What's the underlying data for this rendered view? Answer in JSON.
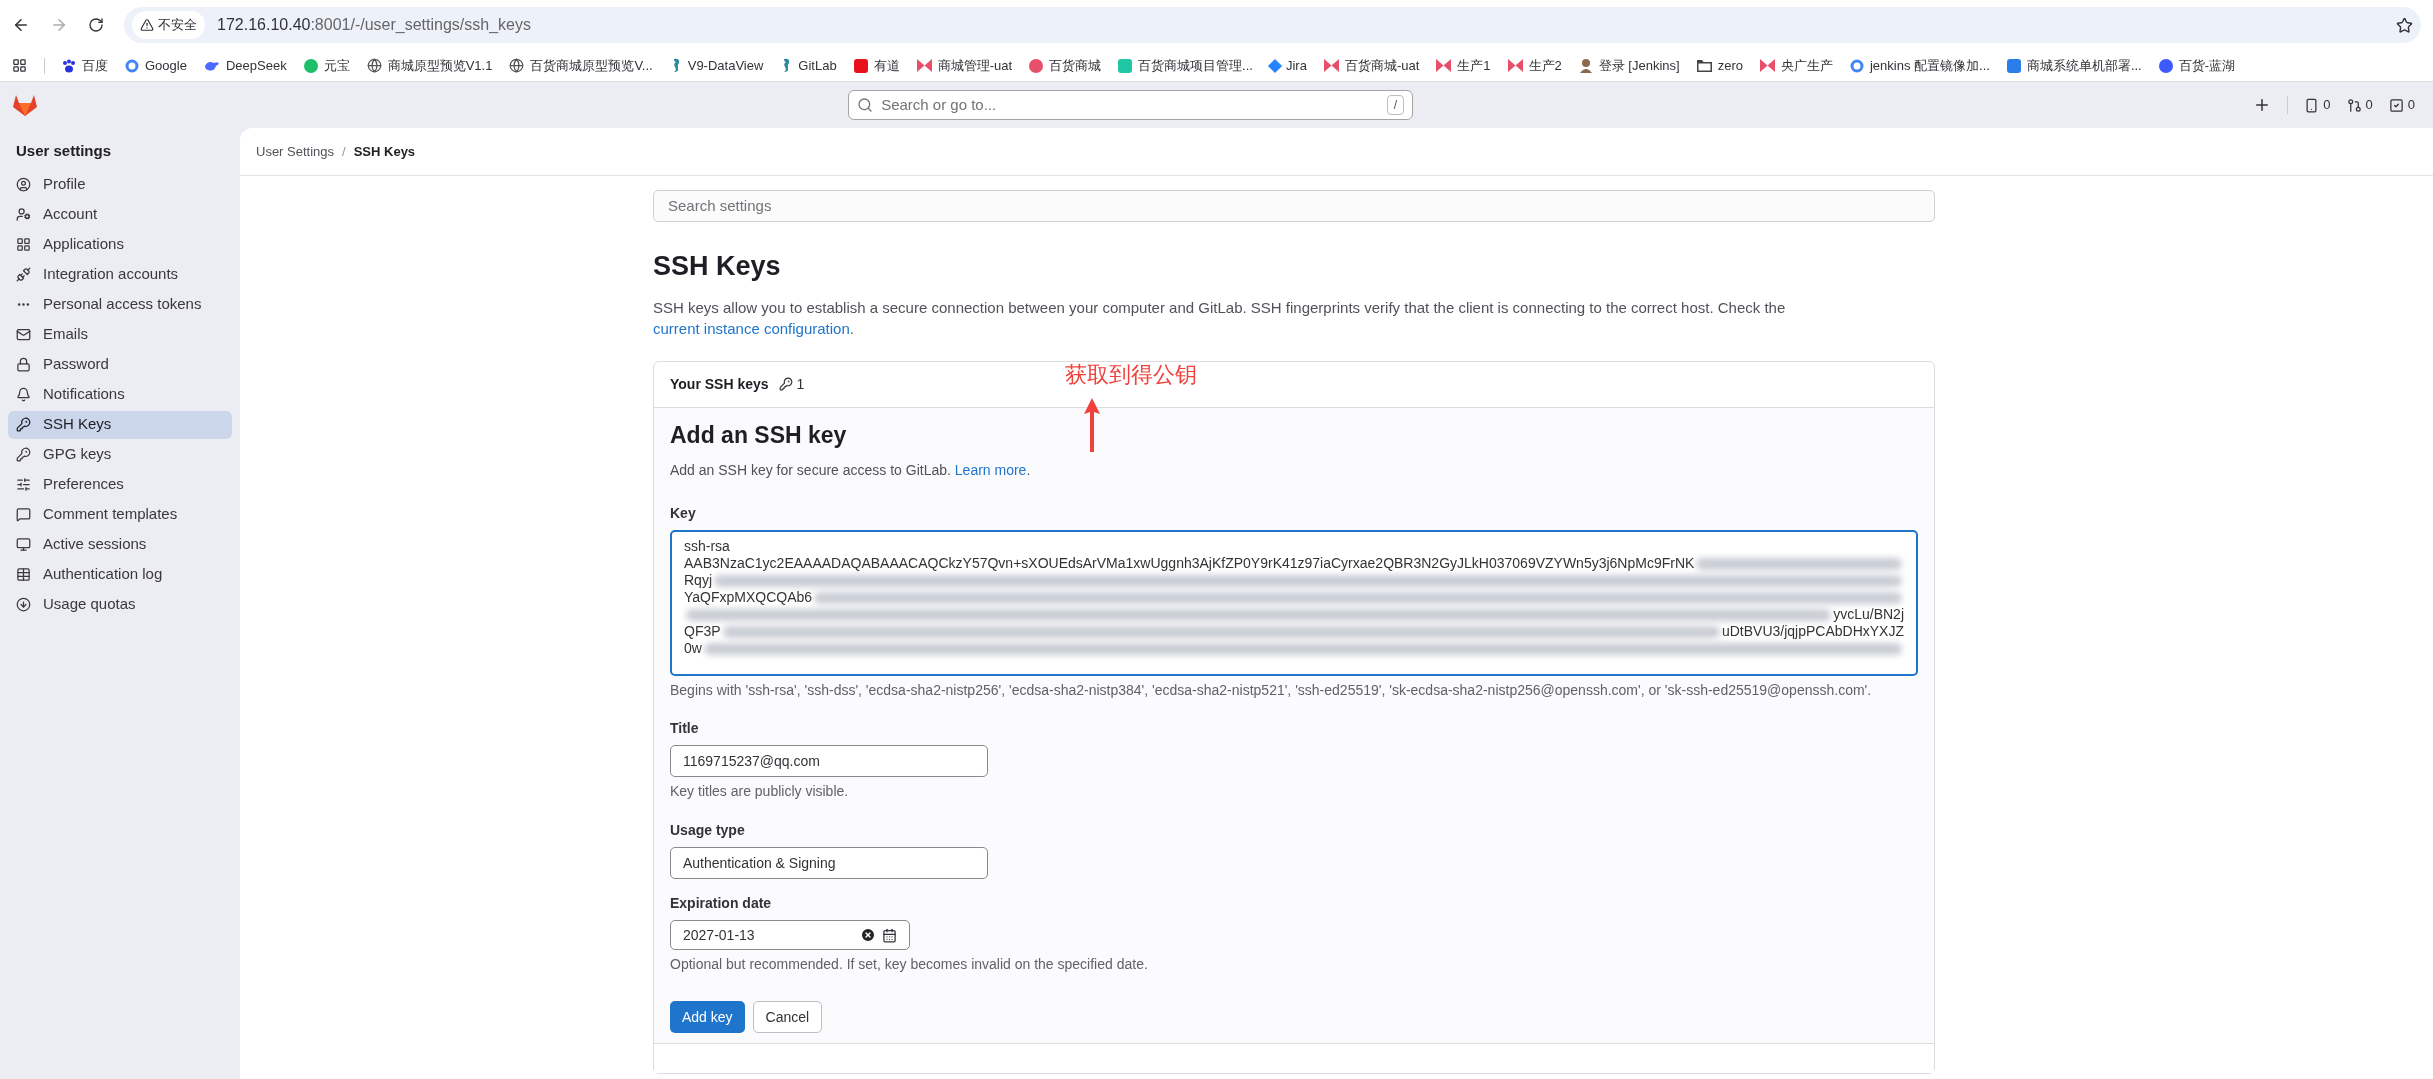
{
  "browser": {
    "security_label": "不安全",
    "url_host": "172.16.10.40",
    "url_rest": ":8001/-/user_settings/ssh_keys"
  },
  "bookmarks": [
    {
      "label": "百度",
      "kind": "paw",
      "color": "#2932e1"
    },
    {
      "label": "Google",
      "kind": "letter",
      "color": "#4285f4"
    },
    {
      "label": "DeepSeek",
      "kind": "whale",
      "color": "#4d6bfe"
    },
    {
      "label": "元宝",
      "kind": "circle",
      "color": "#1ebf6a"
    },
    {
      "label": "商城原型预览V1.1",
      "kind": "globe",
      "color": "#555555"
    },
    {
      "label": "百货商城原型预览V...",
      "kind": "globe",
      "color": "#555555"
    },
    {
      "label": "V9-DataView",
      "kind": "seahorse",
      "color": "#2e8b9a"
    },
    {
      "label": "GitLab",
      "kind": "seahorse",
      "color": "#2e8b9a"
    },
    {
      "label": "有道",
      "kind": "square",
      "color": "#e8111b"
    },
    {
      "label": "商城管理-uat",
      "kind": "bow",
      "color": "#e84f6b"
    },
    {
      "label": "百货商城",
      "kind": "circle",
      "color": "#e84f6b"
    },
    {
      "label": "百货商城项目管理...",
      "kind": "square",
      "color": "#1fc7a4"
    },
    {
      "label": "Jira",
      "kind": "diamond",
      "color": "#2684ff"
    },
    {
      "label": "百货商城-uat",
      "kind": "bow",
      "color": "#e84f6b"
    },
    {
      "label": "生产1",
      "kind": "bow",
      "color": "#e84f6b"
    },
    {
      "label": "生产2",
      "kind": "bow",
      "color": "#e84f6b"
    },
    {
      "label": "登录 [Jenkins]",
      "kind": "figure",
      "color": "#8a6a4f"
    },
    {
      "label": "zero",
      "kind": "folder",
      "color": "#444444"
    },
    {
      "label": "央广生产",
      "kind": "bow",
      "color": "#e84f6b"
    },
    {
      "label": "jenkins 配置镜像加...",
      "kind": "letter",
      "color": "#4285f4"
    },
    {
      "label": "商城系统单机部署...",
      "kind": "square",
      "color": "#2b7de9"
    },
    {
      "label": "百货-蓝湖",
      "kind": "circle",
      "color": "#3d5afe"
    }
  ],
  "topbar": {
    "search_placeholder": "Search or go to...",
    "shortcut": "/",
    "counters": [
      "0",
      "0",
      "0"
    ]
  },
  "sidebar": {
    "title": "User settings",
    "items": [
      {
        "label": "Profile",
        "selected": false
      },
      {
        "label": "Account",
        "selected": false
      },
      {
        "label": "Applications",
        "selected": false
      },
      {
        "label": "Integration accounts",
        "selected": false
      },
      {
        "label": "Personal access tokens",
        "selected": false
      },
      {
        "label": "Emails",
        "selected": false
      },
      {
        "label": "Password",
        "selected": false
      },
      {
        "label": "Notifications",
        "selected": false
      },
      {
        "label": "SSH Keys",
        "selected": true
      },
      {
        "label": "GPG keys",
        "selected": false
      },
      {
        "label": "Preferences",
        "selected": false
      },
      {
        "label": "Comment templates",
        "selected": false
      },
      {
        "label": "Active sessions",
        "selected": false
      },
      {
        "label": "Authentication log",
        "selected": false
      },
      {
        "label": "Usage quotas",
        "selected": false
      }
    ]
  },
  "breadcrumbs": [
    "User Settings",
    "SSH Keys"
  ],
  "breadcrumb_separator": "/",
  "search_settings": {
    "placeholder": "Search settings"
  },
  "page": {
    "title": "SSH Keys",
    "intro": "SSH keys allow you to establish a secure connection between your computer and GitLab. SSH fingerprints verify that the client is connecting to the correct host. Check the",
    "intro_link": "current instance configuration",
    "intro_end": "."
  },
  "card": {
    "header": "Your SSH keys",
    "count": "1",
    "form_title": "Add an SSH key",
    "form_intro": "Add an SSH key for secure access to GitLab.",
    "form_link": "Learn more",
    "form_intro_end": ".",
    "key": {
      "label": "Key",
      "first_line": "ssh-rsa",
      "rows": [
        {
          "left": "AAB3NzaC1yc2EAAAADAQABAAACAQCkzY57Qvn+sXOUEdsArVMa1xwUggnh3AjKfZP0Y9rK41z97iaCyrxae2QBR3N2GyJLkH037069VZYWn5y3j6NpMc9FrNK"
        },
        {
          "left": "Rqyj"
        },
        {
          "left": "YaQFxpMXQCQAb6"
        },
        {
          "right": "yvcLu/BN2j"
        },
        {
          "left": "QF3P",
          "right": "uDtBVU3/jqjpPCAbDHxYXJZ"
        },
        {
          "left": "0w"
        }
      ],
      "help": "Begins with 'ssh-rsa', 'ssh-dss', 'ecdsa-sha2-nistp256', 'ecdsa-sha2-nistp384', 'ecdsa-sha2-nistp521', 'ssh-ed25519', 'sk-ecdsa-sha2-nistp256@openssh.com', or 'sk-ssh-ed25519@openssh.com'."
    },
    "title_field": {
      "label": "Title",
      "value": "1169715237@qq.com",
      "help": "Key titles are publicly visible."
    },
    "usage": {
      "label": "Usage type",
      "value": "Authentication & Signing"
    },
    "expiration": {
      "label": "Expiration date",
      "value": "2027-01-13",
      "help": "Optional but recommended. If set, key becomes invalid on the specified date."
    },
    "buttons": {
      "primary": "Add key",
      "secondary": "Cancel"
    }
  },
  "annotation": {
    "text": "获取到得公钥"
  }
}
